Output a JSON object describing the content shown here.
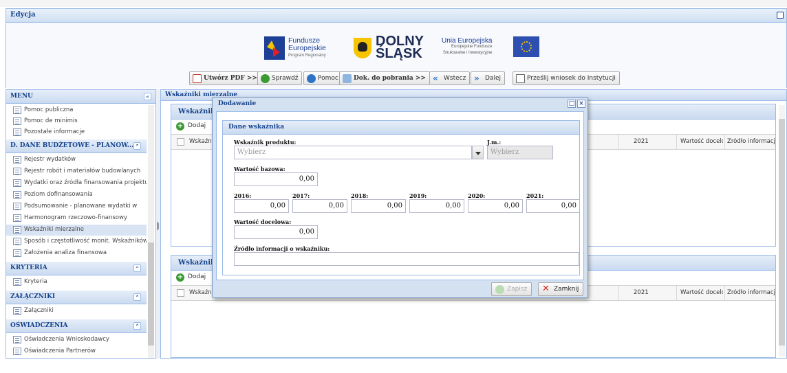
{
  "window": {
    "title": "Edycja"
  },
  "banner": {
    "fe_line1": "Fundusze",
    "fe_line2": "Europejskie",
    "fe_line3": "Program Regionalny",
    "dolny": "DOLNY",
    "slask": "ŚLĄSK",
    "ue_line1": "Unia Europejska",
    "ue_line2": "Europejskie Fundusze",
    "ue_line3": "Strukturalne i Inwestycyjne"
  },
  "toolbar": {
    "pdf": "Utwórz PDF >>",
    "check": "Sprawdź",
    "help": "Pomoc",
    "docs": "Dok. do pobrania >>",
    "back": "Wstecz",
    "next": "Dalej",
    "send": "Prześlij wniosek do Instytucji"
  },
  "menu": {
    "title": "MENU",
    "top_items": [
      "Pomoc publiczna",
      "Pomoc de minimis",
      "Pozostałe informacje"
    ],
    "section_d": "D. DANE BUDŻETOWE - PLANOW...",
    "d_items": [
      "Rejestr wydatków",
      "Rejestr robót i materiałów budowlanych",
      "Wydatki oraz źródła finansowania projektu",
      "Poziom dofinansowania",
      "Podsumowanie - planowane wydatki w",
      "Harmonogram rzeczowo-finansowy",
      "Wskaźniki mierzalne",
      "Sposób i częstotliwość monit. Wskaźników",
      "Założenia analiza finansowa"
    ],
    "section_kryteria": "KRYTERIA",
    "kryteria_items": [
      "Kryteria"
    ],
    "section_zalaczniki": "ZAŁĄCZNIKI",
    "zalaczniki_items": [
      "Załączniki"
    ],
    "section_oswiadczenia": "OŚWIADCZENIA",
    "oswiadczenia_items": [
      "Oświadczenia Wnioskodawcy",
      "Oświadczenia Partnerów"
    ]
  },
  "main": {
    "tab": "Wskaźniki mierzalne",
    "grid1_title": "Wskaźniki",
    "grid2_title": "Wskaźniki",
    "add": "Dodaj",
    "col_first": "Wskaźnik",
    "col_2021": "2021",
    "col_target": "Wartość docelowa",
    "col_source": "Źródło informacji"
  },
  "modal": {
    "title": "Dodawanie",
    "section": "Dane wskaźnika",
    "product_label": "Wskaźnik produktu:",
    "product_placeholder": "Wybierz",
    "unit_label": "J.m.:",
    "unit_placeholder": "Wybierz",
    "base_label": "Wartość bazowa:",
    "base_value": "0,00",
    "years": [
      {
        "label": "2016:",
        "value": "0,00"
      },
      {
        "label": "2017:",
        "value": "0,00"
      },
      {
        "label": "2018:",
        "value": "0,00"
      },
      {
        "label": "2019:",
        "value": "0,00"
      },
      {
        "label": "2020:",
        "value": "0,00"
      },
      {
        "label": "2021:",
        "value": "0,00"
      }
    ],
    "target_label": "Wartość docelowa:",
    "target_value": "0,00",
    "source_label": "Źródło informacji o wskaźniku:",
    "source_value": "",
    "save": "Zapisz",
    "close": "Zamknij"
  }
}
